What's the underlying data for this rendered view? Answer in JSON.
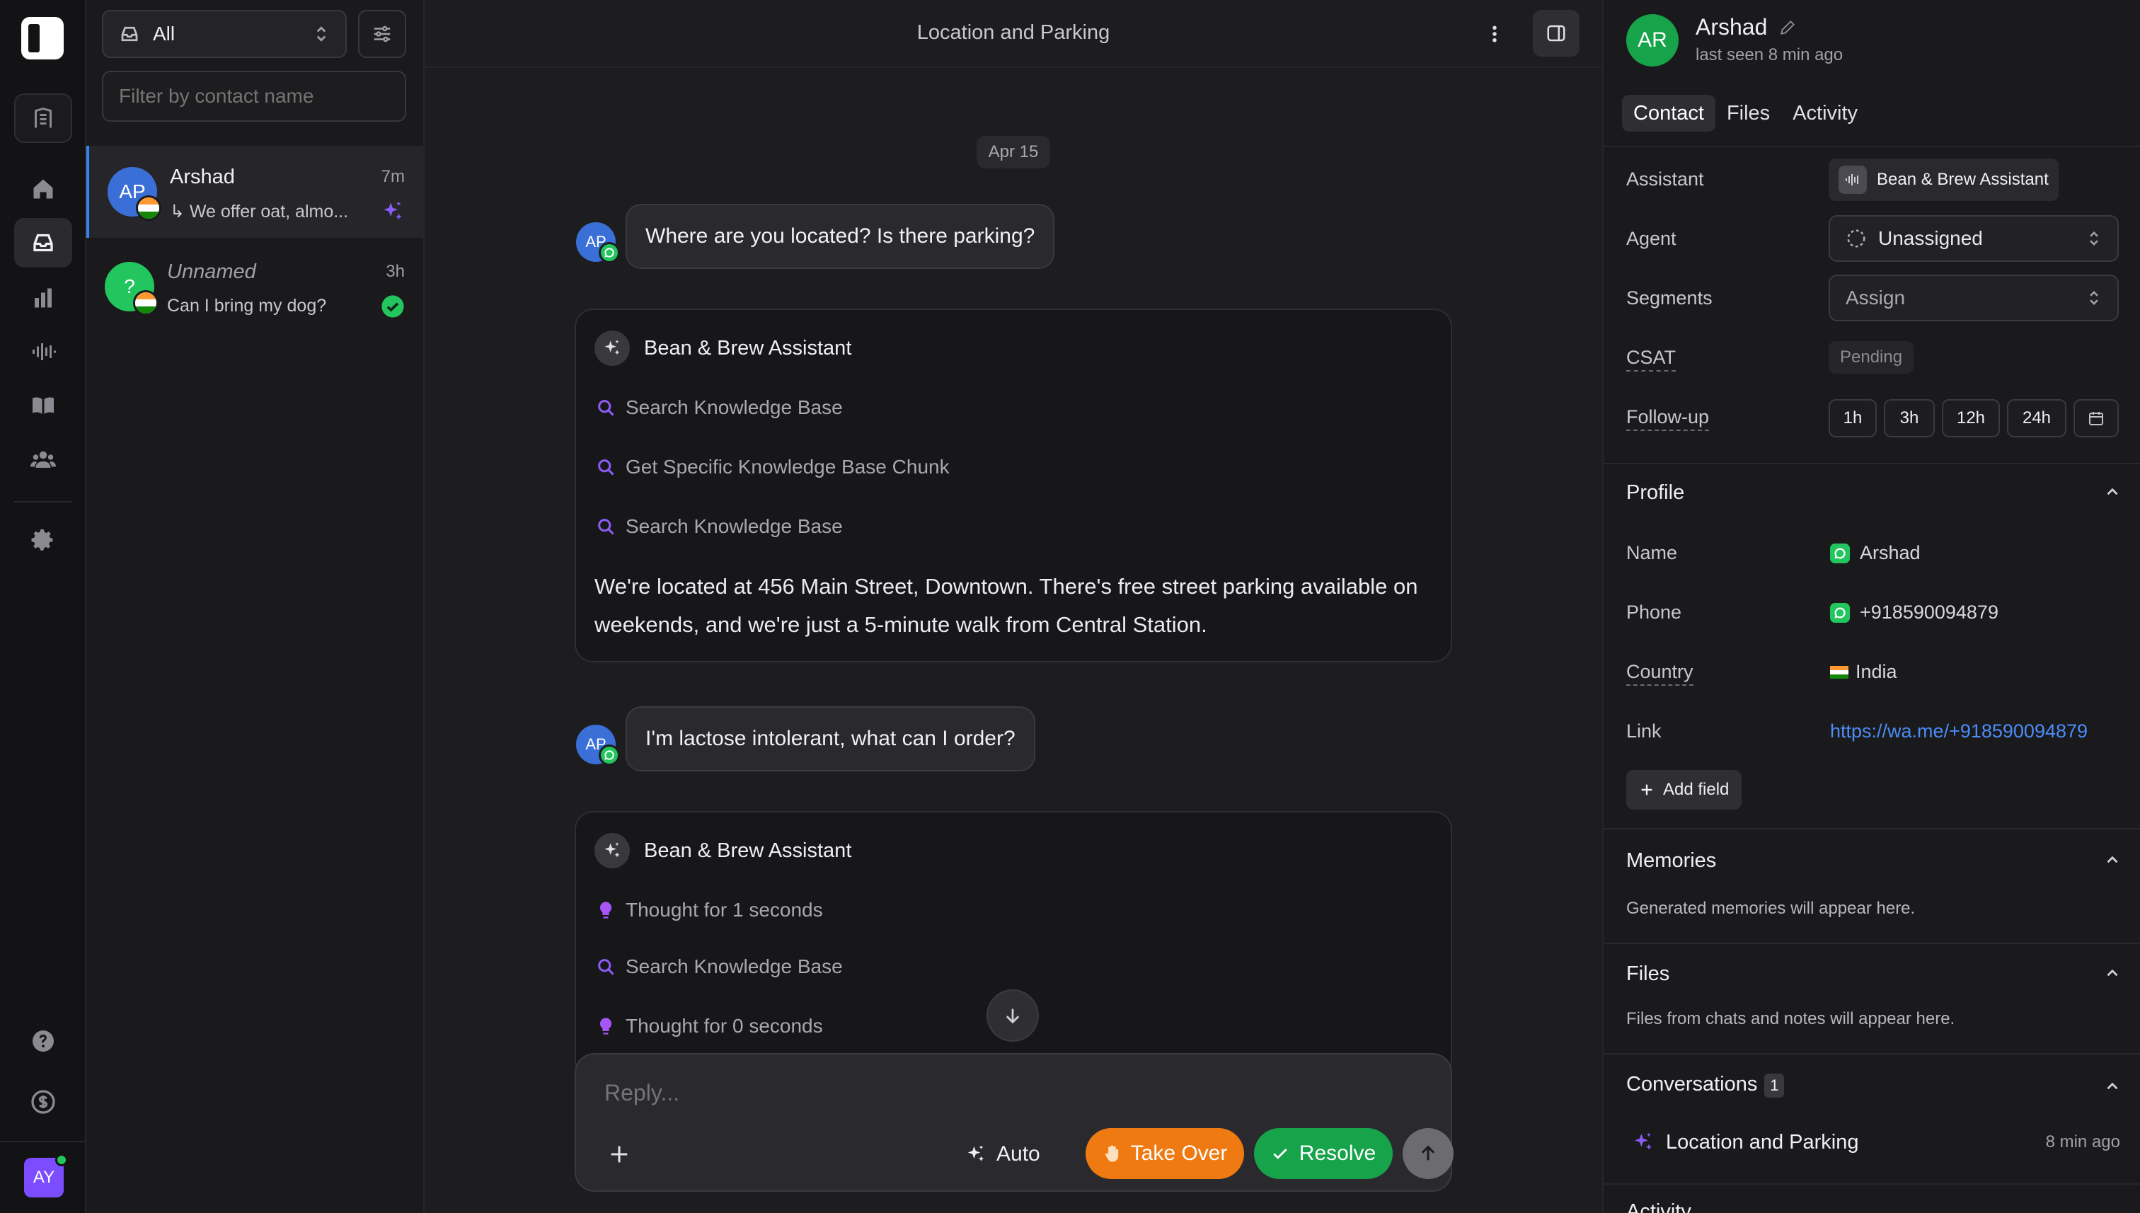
{
  "nav": {
    "items": [
      "home",
      "inbox",
      "analytics",
      "voice",
      "knowledge",
      "contacts",
      "settings"
    ],
    "help_icon": "help-circle-icon",
    "billing_icon": "dollar-circle-icon",
    "user_initials": "AY"
  },
  "list": {
    "filter_value": "All",
    "search_placeholder": "Filter by contact name",
    "conversations": [
      {
        "initials": "AP",
        "name": "Arshad",
        "time": "7m",
        "preview": "↳ We offer oat, almo...",
        "color": "#3b6fd8",
        "status": "ai-active"
      },
      {
        "initials": "?",
        "name": "Unnamed",
        "time": "3h",
        "preview": "Can I bring my dog?",
        "color": "#22c55e",
        "status": "resolved"
      }
    ]
  },
  "chat": {
    "title": "Location and Parking",
    "date": "Apr 15",
    "messages": [
      {
        "initials": "AP",
        "text": "Where are you located? Is there parking?"
      },
      {
        "initials": "AP",
        "text": "I'm lactose intolerant, what can I order?"
      }
    ],
    "assistant_blocks": [
      {
        "name": "Bean & Brew Assistant",
        "steps": [
          "Search Knowledge Base",
          "Get Specific Knowledge Base Chunk",
          "Search Knowledge Base"
        ],
        "body": "We're located at 456 Main Street, Downtown. There's free street parking available on weekends, and we're just a 5-minute walk from Central Station."
      },
      {
        "name": "Bean & Brew Assistant",
        "steps": [
          "Thought for 1 seconds",
          "Search Knowledge Base",
          "Thought for 0 seconds"
        ]
      }
    ],
    "composer": {
      "placeholder": "Reply...",
      "auto_label": "Auto",
      "take_over_label": "Take Over",
      "resolve_label": "Resolve"
    },
    "colors": {
      "take_over": "#f07a12",
      "resolve": "#16a34a"
    }
  },
  "contact": {
    "initials": "AR",
    "name": "Arshad",
    "last_seen": "last seen 8 min ago",
    "tabs": [
      "Contact",
      "Files",
      "Activity"
    ],
    "fields": {
      "assistant_label": "Assistant",
      "assistant_value": "Bean & Brew Assistant",
      "agent_label": "Agent",
      "agent_value": "Unassigned",
      "segments_label": "Segments",
      "segments_value": "Assign",
      "csat_label": "CSAT",
      "csat_value": "Pending",
      "followup_label": "Follow-up",
      "followup_options": [
        "1h",
        "3h",
        "12h",
        "24h"
      ]
    },
    "profile": {
      "title": "Profile",
      "name_label": "Name",
      "name_value": "Arshad",
      "phone_label": "Phone",
      "phone_value": "+918590094879",
      "country_label": "Country",
      "country_value": "India",
      "link_label": "Link",
      "link_value": "https://wa.me/+918590094879",
      "add_field": "Add field"
    },
    "memories": {
      "title": "Memories",
      "note": "Generated memories will appear here."
    },
    "files": {
      "title": "Files",
      "note": "Files from chats and notes will appear here."
    },
    "conversations": {
      "title": "Conversations",
      "count": "1",
      "items": [
        {
          "title": "Location and Parking",
          "ago": "8 min ago"
        }
      ]
    },
    "activity": {
      "title": "Activity"
    }
  }
}
